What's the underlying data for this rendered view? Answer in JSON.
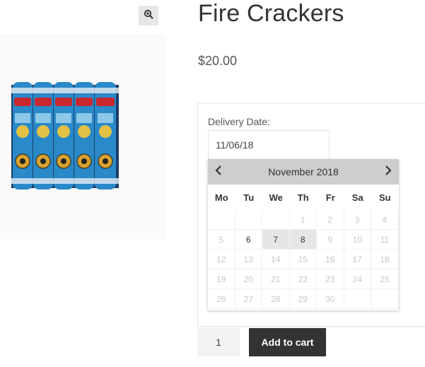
{
  "product": {
    "title": "Fire Crackers",
    "price": "$20.00",
    "quantity": "1",
    "add_to_cart_label": "Add to cart"
  },
  "delivery": {
    "label": "Delivery Date:",
    "value": "11/06/18"
  },
  "calendar": {
    "month_label": "November 2018",
    "weekdays": [
      "Mo",
      "Tu",
      "We",
      "Th",
      "Fr",
      "Sa",
      "Su"
    ],
    "rows": [
      [
        "",
        "",
        "",
        "1",
        "2",
        "3",
        "4"
      ],
      [
        "5",
        "6",
        "7",
        "8",
        "9",
        "10",
        "11"
      ],
      [
        "12",
        "13",
        "14",
        "15",
        "16",
        "17",
        "18"
      ],
      [
        "19",
        "20",
        "21",
        "22",
        "23",
        "24",
        "25"
      ],
      [
        "26",
        "27",
        "28",
        "29",
        "30",
        "",
        ""
      ]
    ],
    "enabled_days": [
      "6",
      "7",
      "8"
    ],
    "highlighted_days": [
      "7",
      "8"
    ]
  },
  "icons": {
    "zoom": "zoom-in-icon",
    "prev": "chevron-left-icon",
    "next": "chevron-right-icon"
  },
  "colors": {
    "button_bg": "#333333",
    "calendar_header_bg": "#cecece",
    "highlight_bg": "#e6e6e6"
  }
}
